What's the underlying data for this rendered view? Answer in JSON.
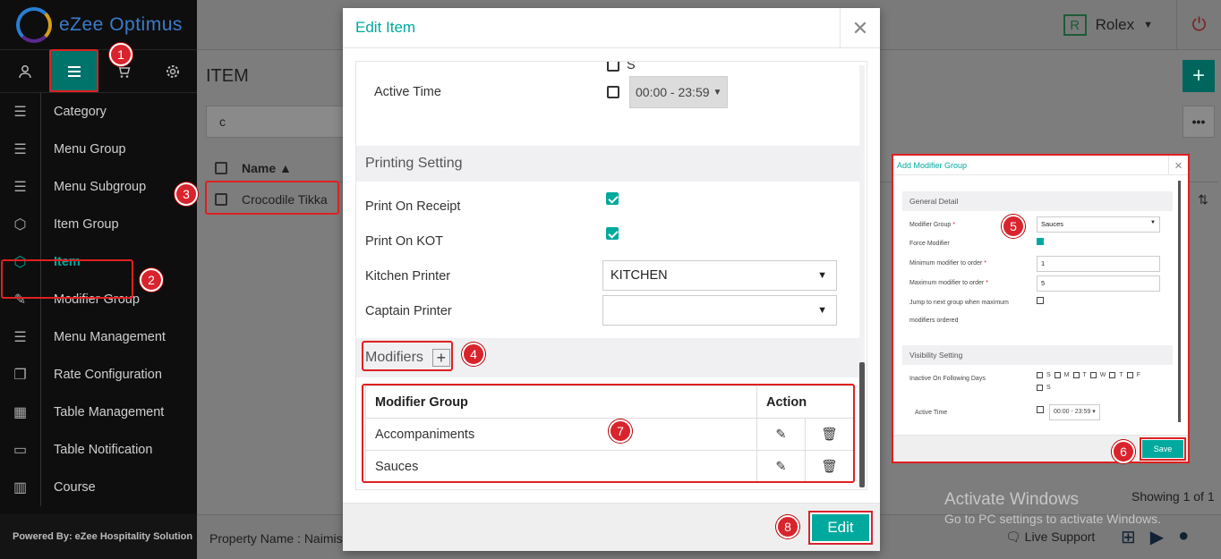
{
  "app": {
    "logo_text": "eZee Optimus"
  },
  "sidebar": {
    "top_icons": [
      "user-icon",
      "menu-icon",
      "cart-icon",
      "gear-icon"
    ],
    "items": [
      {
        "label": "Category",
        "icon": "list-icon"
      },
      {
        "label": "Menu Group",
        "icon": "list-icon"
      },
      {
        "label": "Menu Subgroup",
        "icon": "list-icon"
      },
      {
        "label": "Item Group",
        "icon": "cube-icon"
      },
      {
        "label": "Item",
        "icon": "cube-icon",
        "active": true
      },
      {
        "label": "Modifier Group",
        "icon": "edit-icon"
      },
      {
        "label": "Menu Management",
        "icon": "list-icon"
      },
      {
        "label": "Rate Configuration",
        "icon": "copy-icon"
      },
      {
        "label": "Table Management",
        "icon": "grid-icon"
      },
      {
        "label": "Table Notification",
        "icon": "chat-icon"
      },
      {
        "label": "Course",
        "icon": "book-icon"
      }
    ],
    "footer": "Powered By: eZee Hospitality Solution"
  },
  "topbar": {
    "badge": "R",
    "user": "Rolex"
  },
  "page": {
    "title": "ITEM",
    "search_value": "c",
    "column_name": "Name",
    "row": "Crocodile Tikka",
    "showing": "Showing 1 of 1"
  },
  "footer": {
    "property": "Property Name : Naimis",
    "live_support": "Live Support"
  },
  "watermark": {
    "line1": "Activate Windows",
    "line2": "Go to PC settings to activate Windows."
  },
  "modal": {
    "title": "Edit Item",
    "day_s": "S",
    "active_time_label": "Active Time",
    "active_time_value": "00:00 - 23:59",
    "printing_setting": "Printing Setting",
    "print_on_receipt": "Print On Receipt",
    "print_on_kot": "Print On KOT",
    "kitchen_printer_label": "Kitchen Printer",
    "kitchen_printer_value": "KITCHEN",
    "captain_printer_label": "Captain Printer",
    "captain_printer_value": "",
    "modifiers_label": "Modifiers",
    "table": {
      "headers": [
        "Modifier Group",
        "Action"
      ],
      "rows": [
        "Accompaniments",
        "Sauces"
      ]
    },
    "edit_button": "Edit"
  },
  "inset": {
    "title": "Add Modifier Group",
    "general_detail": "General Detail",
    "modifier_group_label": "Modifier Group",
    "modifier_group_value": "Sauces",
    "force_modifier": "Force Modifier",
    "min_label": "Minimum modifier to order",
    "min_value": "1",
    "max_label": "Maximum modifier to order",
    "max_value": "5",
    "jump_label_1": "Jump to next group when maximum",
    "jump_label_2": "modifiers ordered",
    "visibility_setting": "Visibility Setting",
    "inactive_days_label": "Inactive On Following Days",
    "days": [
      "S",
      "M",
      "T",
      "W",
      "T",
      "F",
      "S"
    ],
    "active_time_label": "Active Time",
    "active_time_value": "00:00 - 23:59",
    "save_button": "Save"
  },
  "annotations": [
    "1",
    "2",
    "3",
    "4",
    "5",
    "6",
    "7",
    "8"
  ],
  "colors": {
    "accent": "#00a99d",
    "highlight": "#e02020",
    "sidebar_bg": "#0e0e0e"
  }
}
